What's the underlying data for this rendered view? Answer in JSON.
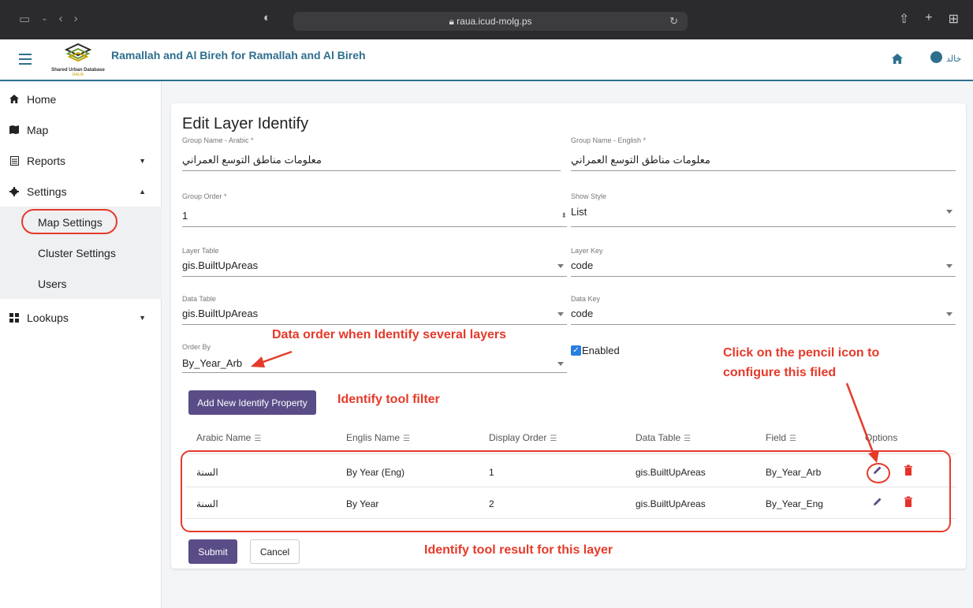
{
  "browser": {
    "url": "raua.icud-molg.ps"
  },
  "header": {
    "title": "Ramallah and Al Bireh for Ramallah and Al Bireh",
    "logo_text": "Shared Urban Database",
    "logo_sub": "RAUA",
    "user_name": "خالد"
  },
  "sidebar": {
    "items": [
      {
        "label": "Home",
        "icon": "home-icon"
      },
      {
        "label": "Map",
        "icon": "map-icon"
      },
      {
        "label": "Reports",
        "icon": "reports-icon"
      },
      {
        "label": "Settings",
        "icon": "gear-icon"
      },
      {
        "label": "Lookups",
        "icon": "lookups-icon"
      }
    ],
    "sub_items": [
      {
        "label": "Map Settings"
      },
      {
        "label": "Cluster Settings"
      },
      {
        "label": "Users"
      }
    ]
  },
  "form": {
    "title": "Edit Layer Identify",
    "group_name_arabic": {
      "label": "Group Name - Arabic *",
      "value": "معلومات مناطق التوسع العمراني"
    },
    "group_name_english": {
      "label": "Group Name - English *",
      "value": "معلومات مناطق التوسع العمراني"
    },
    "group_order": {
      "label": "Group Order *",
      "value": "1"
    },
    "show_style": {
      "label": "Show Style",
      "value": "List"
    },
    "layer_table": {
      "label": "Layer Table",
      "value": "gis.BuiltUpAreas"
    },
    "layer_key": {
      "label": "Layer Key",
      "value": "code"
    },
    "data_table": {
      "label": "Data Table",
      "value": "gis.BuiltUpAreas"
    },
    "data_key": {
      "label": "Data Key",
      "value": "code"
    },
    "order_by": {
      "label": "Order By",
      "value": "By_Year_Arb"
    },
    "enabled": {
      "label": "Enabled",
      "checked": true
    },
    "add_button": "Add New Identify Property",
    "submit_button": "Submit",
    "cancel_button": "Cancel"
  },
  "table": {
    "headers": [
      "Arabic Name",
      "Englis Name",
      "Display Order",
      "Data Table",
      "Field",
      "Options"
    ],
    "rows": [
      {
        "arabic": "السنة",
        "english": "By Year (Eng)",
        "order": "1",
        "table": "gis.BuiltUpAreas",
        "field": "By_Year_Arb"
      },
      {
        "arabic": "السنة",
        "english": "By Year",
        "order": "2",
        "table": "gis.BuiltUpAreas",
        "field": "By_Year_Eng"
      }
    ]
  },
  "annotations": {
    "data_order": "Data order when Identify several layers",
    "pencil_line1": "Click on the pencil icon to",
    "pencil_line2": "configure this filed",
    "filter": "Identify tool filter",
    "result": "Identify tool result for this layer"
  },
  "colors": {
    "brand": "#2e6f8e",
    "primary_button": "#5a4c87",
    "annotation": "#e53a2a",
    "checkbox": "#2a7de1",
    "delete": "#e5322a"
  }
}
